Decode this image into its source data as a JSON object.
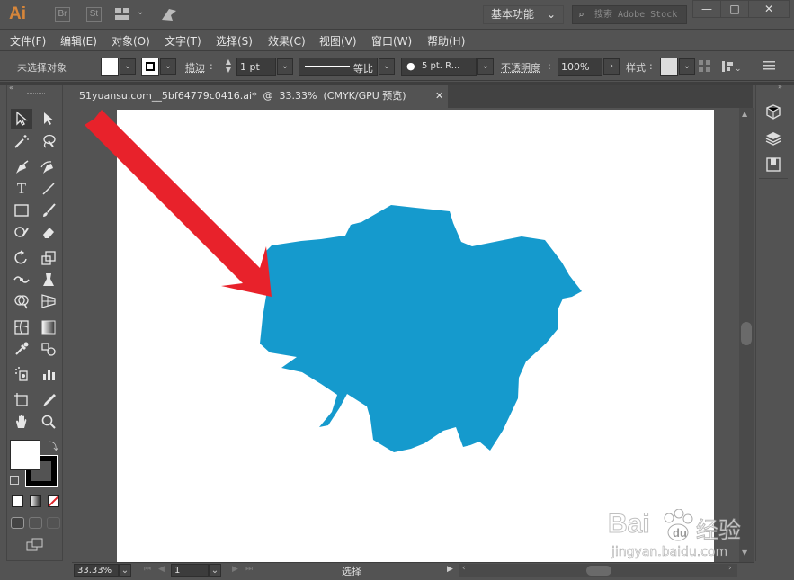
{
  "app": {
    "logo": "Ai",
    "bridge_label": "Br",
    "stock_label": "St"
  },
  "titlebar": {
    "workspace": "基本功能",
    "stock_search_placeholder": "搜索 Adobe Stock",
    "minimize": "—",
    "maximize": "□",
    "close": "✕"
  },
  "menu": [
    "文件(F)",
    "编辑(E)",
    "对象(O)",
    "文字(T)",
    "选择(S)",
    "效果(C)",
    "视图(V)",
    "窗口(W)",
    "帮助(H)"
  ],
  "controlbar": {
    "selection_status": "未选择对象",
    "stroke_label": "描边",
    "stroke_weight": "1 pt",
    "stroke_profile": "等比",
    "brush": "5 pt. R...",
    "opacity_label": "不透明度",
    "opacity_value": "100%",
    "style_label": "样式"
  },
  "document": {
    "tab_title": "51yuansu.com__5bf64779c0416.ai*  @  33.33%  (CMYK/GPU 预览)",
    "close": "✕"
  },
  "statusbar": {
    "zoom": "33.33%",
    "artboard_number": "1",
    "tool_status": "选择"
  },
  "watermark": {
    "brand": "Bai",
    "brand_cn": "经验",
    "url": "jingyan.baidu.com"
  },
  "colors": {
    "shape_fill": "#159acd",
    "arrow": "#e8222b",
    "ui_bg": "#535353",
    "artboard": "#ffffff",
    "logo": "#d7863a"
  },
  "icons": [
    "selection-tool-icon",
    "direct-selection-tool-icon",
    "magic-wand-icon",
    "lasso-icon",
    "pen-icon",
    "curvature-icon",
    "type-icon",
    "line-icon",
    "rectangle-icon",
    "paintbrush-icon",
    "shaper-icon",
    "eraser-icon",
    "rotate-icon",
    "scale-icon",
    "width-icon",
    "puppet-warp-icon",
    "shape-builder-icon",
    "perspective-icon",
    "mesh-icon",
    "gradient-icon",
    "eyedropper-icon",
    "blend-icon",
    "symbol-sprayer-icon",
    "graph-icon",
    "artboard-tool-icon",
    "slice-icon",
    "hand-icon",
    "zoom-icon"
  ]
}
